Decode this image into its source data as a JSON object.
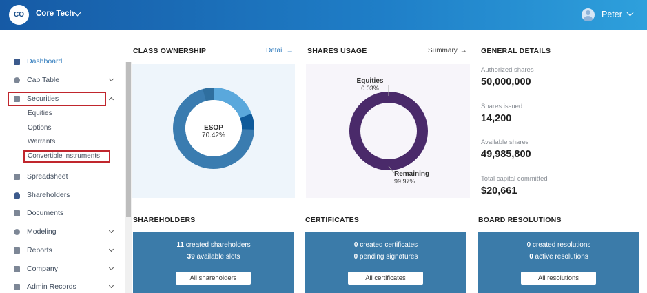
{
  "header": {
    "logo_initials": "CO",
    "company_name": "Core Tech",
    "user_name": "Peter"
  },
  "sidebar": {
    "items": [
      {
        "label": "Dashboard",
        "icon": "dashboard-icon"
      },
      {
        "label": "Cap Table",
        "icon": "pie-chart-icon"
      },
      {
        "label": "Securities",
        "icon": "clipboard-icon"
      },
      {
        "label": "Spreadsheet",
        "icon": "spreadsheet-icon"
      },
      {
        "label": "Shareholders",
        "icon": "person-icon"
      },
      {
        "label": "Documents",
        "icon": "documents-icon"
      },
      {
        "label": "Modeling",
        "icon": "lightbulb-icon"
      },
      {
        "label": "Reports",
        "icon": "reports-icon"
      },
      {
        "label": "Company",
        "icon": "company-icon"
      },
      {
        "label": "Admin Records",
        "icon": "admin-records-icon"
      }
    ],
    "securities_sub": [
      "Equities",
      "Options",
      "Warrants",
      "Convertible instruments"
    ]
  },
  "class_ownership": {
    "title": "CLASS OWNERSHIP",
    "link": "Detail",
    "center_label": "ESOP",
    "center_value": "70.42%"
  },
  "shares_usage": {
    "title": "SHARES USAGE",
    "link": "Summary",
    "equities_label": "Equities",
    "equities_value": "0.03%",
    "remaining_label": "Remaining",
    "remaining_value": "99.97%"
  },
  "general_details": {
    "title": "GENERAL DETAILS",
    "items": [
      {
        "label": "Authorized shares",
        "value": "50,000,000"
      },
      {
        "label": "Shares issued",
        "value": "14,200"
      },
      {
        "label": "Available shares",
        "value": "49,985,800"
      },
      {
        "label": "Total capital committed",
        "value": "$20,661"
      }
    ]
  },
  "shareholders": {
    "title": "SHAREHOLDERS",
    "line1_num": "11",
    "line1_text": "created shareholders",
    "line2_num": "39",
    "line2_text": "available slots",
    "button": "All shareholders"
  },
  "certificates": {
    "title": "CERTIFICATES",
    "line1_num": "0",
    "line1_text": "created certificates",
    "line2_num": "0",
    "line2_text": "pending signatures",
    "button": "All certificates"
  },
  "board_resolutions": {
    "title": "BOARD RESOLUTIONS",
    "line1_num": "0",
    "line1_text": "created resolutions",
    "line2_num": "0",
    "line2_text": "active resolutions",
    "button": "All resolutions"
  },
  "colors": {
    "header_start": "#165aa5",
    "header_end": "#2ea0dc",
    "card_bg": "#3b7ba9",
    "esop": "#3a7cb0",
    "remaining": "#4a2a6a",
    "highlight": "#c0262d"
  }
}
